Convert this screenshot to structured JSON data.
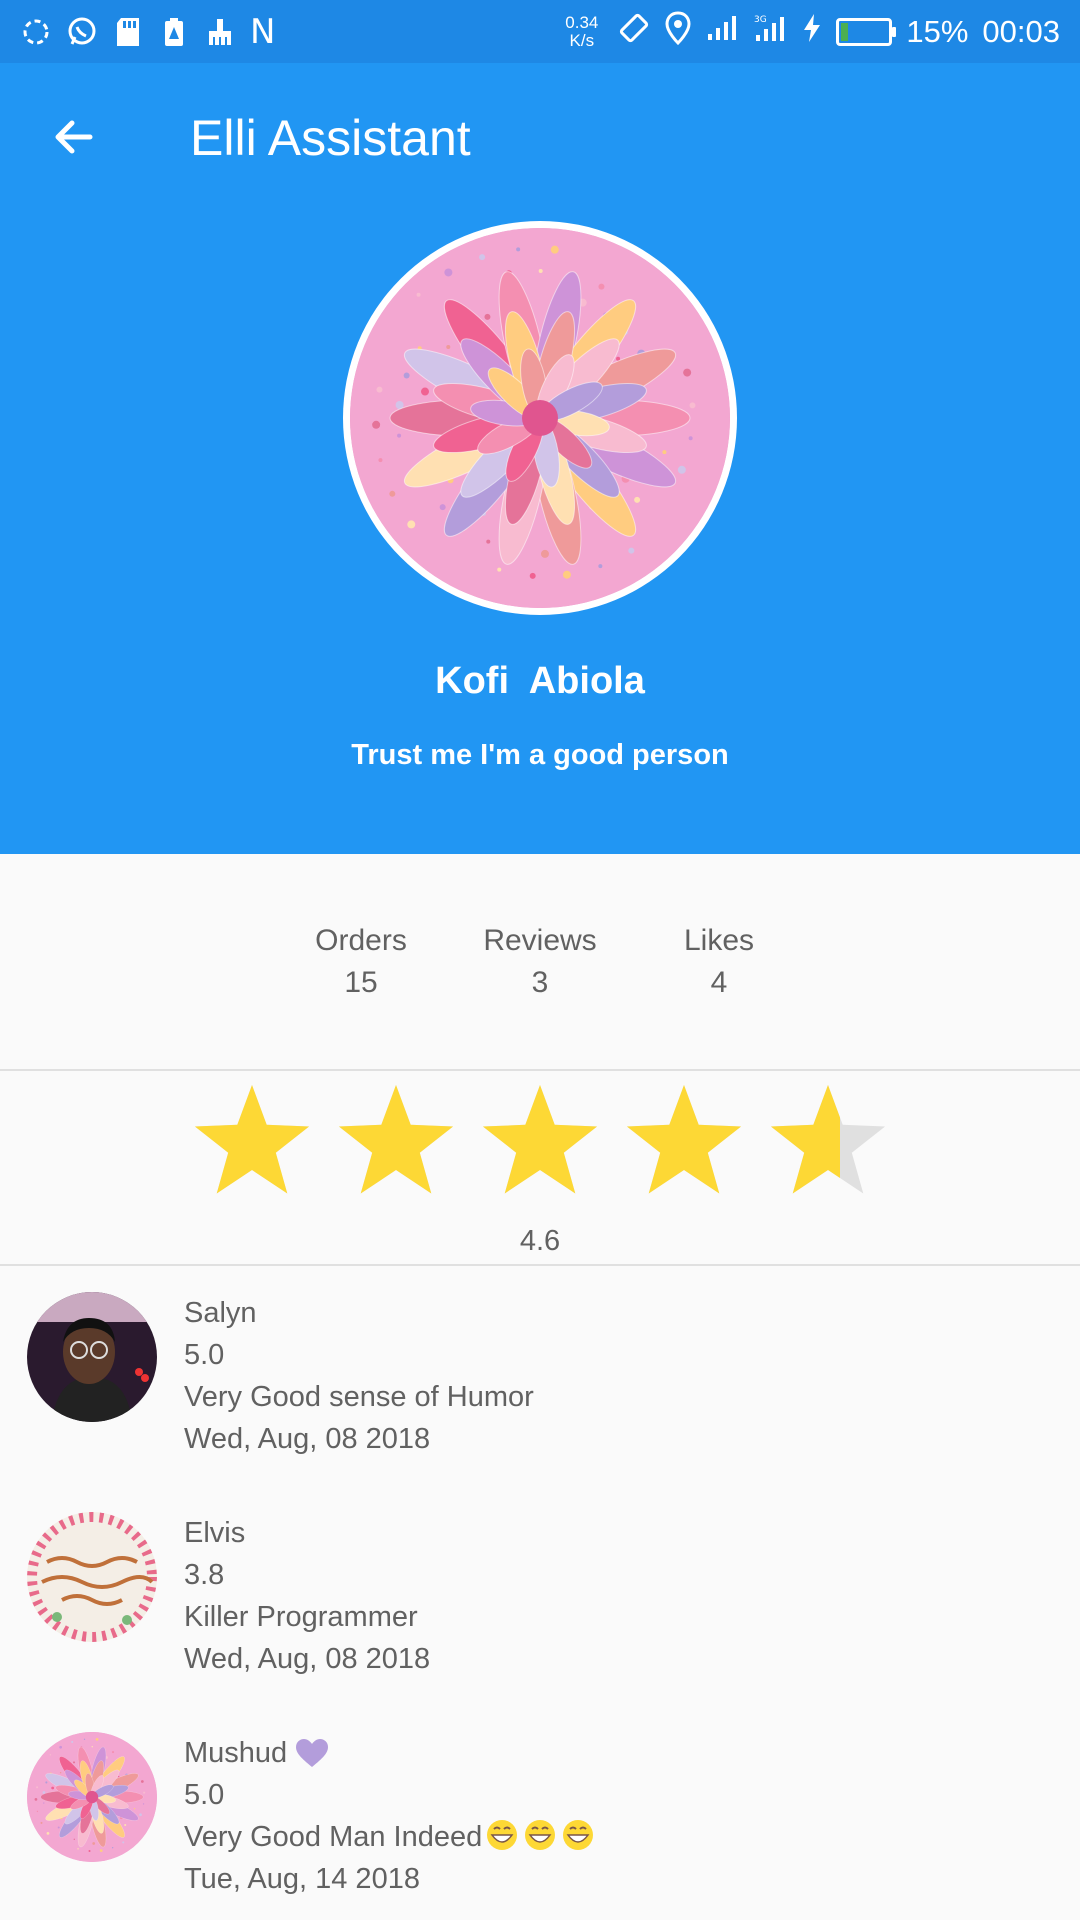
{
  "status_bar": {
    "net_speed_value": "0.34",
    "net_speed_unit": "K/s",
    "battery_percent": "15%",
    "battery_level": 0.15,
    "time": "00:03",
    "n_label": "N"
  },
  "appbar": {
    "title": "Elli Assistant",
    "back_icon": "arrow-back-icon"
  },
  "profile": {
    "name": "Kofi  Abiola",
    "bio": "Trust me I'm a good person"
  },
  "stats": [
    {
      "label": "Orders",
      "value": "15"
    },
    {
      "label": "Reviews",
      "value": "3"
    },
    {
      "label": "Likes",
      "value": "4"
    }
  ],
  "rating": {
    "value": "4.6",
    "stars_filled": 4.6,
    "stars_total": 5,
    "star_color": "#fdd835",
    "star_empty_color": "#e0e0e0"
  },
  "reviews": [
    {
      "name": "Salyn",
      "score": "5.0",
      "comment": "Very Good sense of Humor",
      "date": "Wed, Aug, 08 2018"
    },
    {
      "name": "Elvis",
      "score": "3.8",
      "comment": "Killer Programmer",
      "date": "Wed, Aug, 08 2018"
    },
    {
      "name": "Mushud",
      "score": "5.0",
      "comment": "Very Good Man Indeed",
      "date": "Tue, Aug, 14 2018"
    }
  ],
  "colors": {
    "primary": "#2196f3",
    "status_bar": "#1e88e5",
    "text_secondary": "#616161"
  }
}
